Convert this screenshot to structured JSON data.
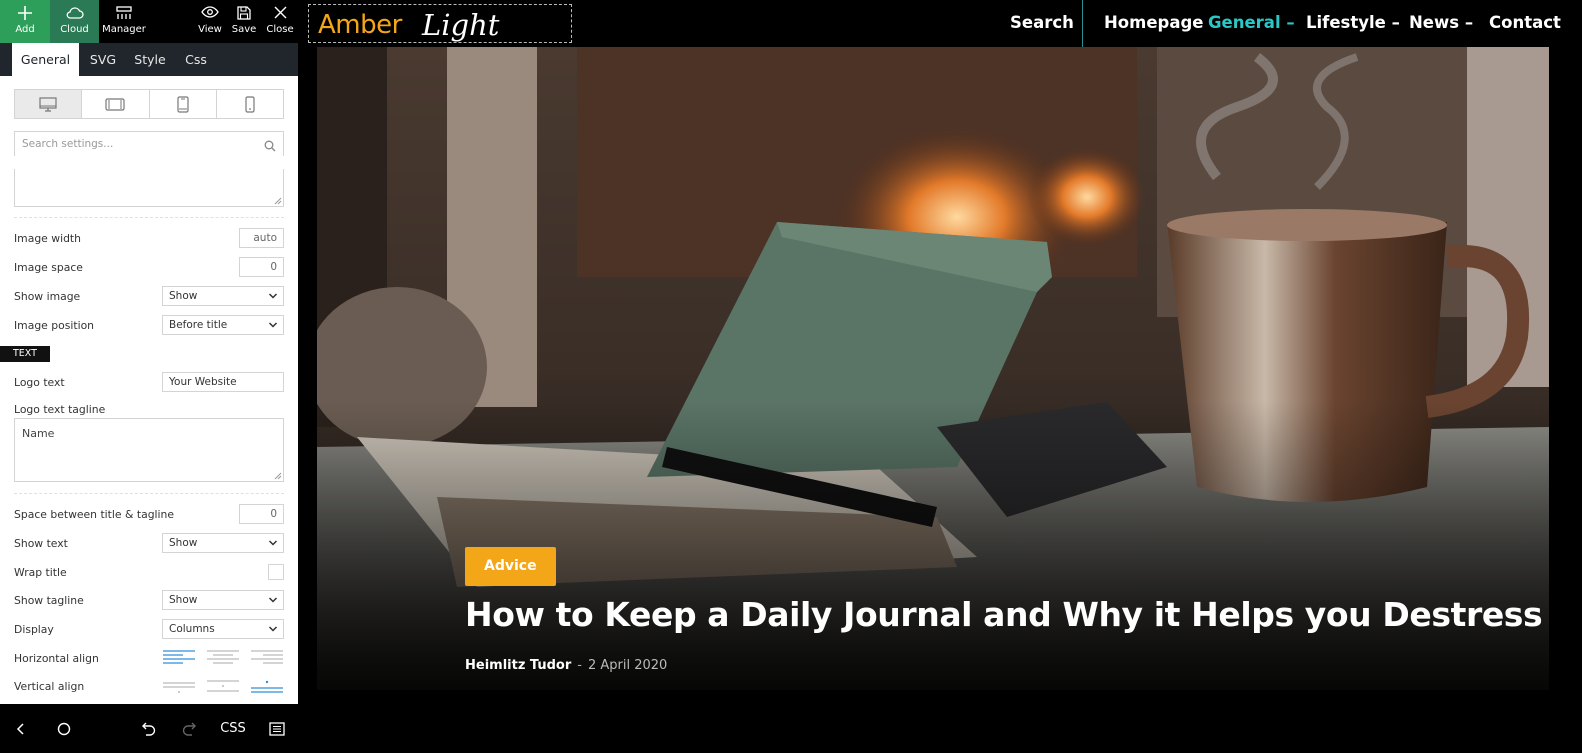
{
  "toolbar": {
    "add": "Add",
    "cloud": "Cloud",
    "manager": "Manager",
    "view": "View",
    "save": "Save",
    "close": "Close"
  },
  "tabs": [
    "General",
    "SVG",
    "Style",
    "Css"
  ],
  "search": {
    "placeholder": "Search settings..."
  },
  "settings": {
    "image_width": {
      "label": "Image width",
      "value": "auto"
    },
    "image_space": {
      "label": "Image space",
      "value": "0"
    },
    "show_image": {
      "label": "Show image",
      "value": "Show"
    },
    "image_position": {
      "label": "Image position",
      "value": "Before title"
    },
    "section_text": "TEXT",
    "logo_text": {
      "label": "Logo text",
      "value": "Your Website"
    },
    "logo_tagline": {
      "label": "Logo text tagline",
      "value": "Name"
    },
    "space_title_tagline": {
      "label": "Space between title & tagline",
      "value": "0"
    },
    "show_text": {
      "label": "Show text",
      "value": "Show"
    },
    "wrap_title": {
      "label": "Wrap title"
    },
    "show_tagline": {
      "label": "Show tagline",
      "value": "Show"
    },
    "display": {
      "label": "Display",
      "value": "Columns"
    },
    "horizontal_align": {
      "label": "Horizontal align"
    },
    "vertical_align": {
      "label": "Vertical align"
    }
  },
  "bottom": {
    "css": "CSS"
  },
  "site": {
    "logo_main": "Amber",
    "logo_script": "Light",
    "nav": {
      "search": "Search",
      "homepage": "Homepage",
      "general": "General",
      "lifestyle": "Lifestyle",
      "news": "News",
      "contact": "Contact"
    },
    "hero": {
      "badge": "Advice",
      "title": "How to Keep a Daily Journal and Why it Helps you Destress",
      "author": "Heimlitz Tudor",
      "date": "2 April 2020"
    }
  },
  "colors": {
    "accent": "#f4a619",
    "nav_active": "#2bc7c7",
    "add_button": "#2e9e5b",
    "cloud_button": "#2a7a55",
    "align_active": "#2f8fd8"
  }
}
